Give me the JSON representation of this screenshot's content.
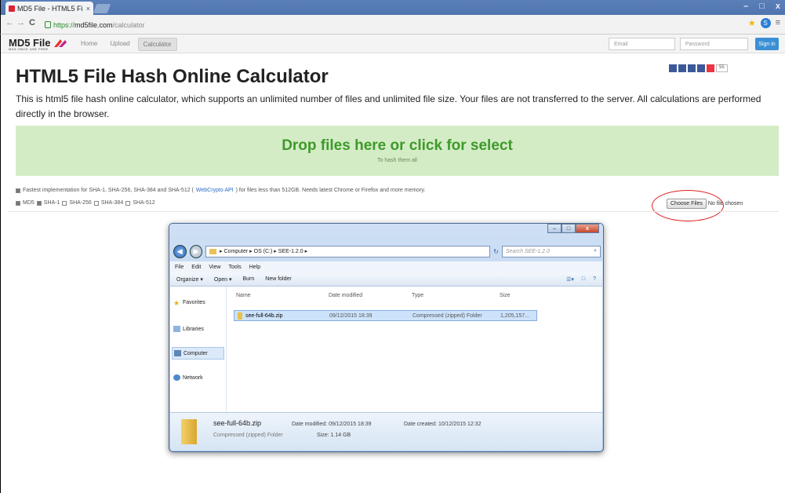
{
  "browser": {
    "tab_title": "MD5 File - HTML5 Fi",
    "tab_close": "×",
    "url_https": "https://",
    "url_host": "md5file.com",
    "url_path": "/calculator",
    "window_controls": [
      "–",
      "□",
      "x"
    ]
  },
  "site": {
    "logo": "MD5 File",
    "logo_sub": "MD5 ONCE USE FREE",
    "nav": [
      "Home",
      "Upload",
      "Calculator"
    ],
    "active_nav": "Calculator",
    "email_placeholder": "Email",
    "password_placeholder": "Password",
    "signin": "Sign in",
    "share_count": "55"
  },
  "main": {
    "title": "HTML5 File Hash Online Calculator",
    "description": "This is html5 file hash online calculator, which supports an unlimited number of files and unlimited file size. Your files are not transferred to the server. All calculations are performed directly in the browser.",
    "drop_title": "Drop files here or click for select",
    "drop_sub": "To hash them all",
    "option_pre": "Fastest implementation for SHA-1, SHA-256, SHA-384 and SHA-512 (",
    "option_link": "WebCrypto API",
    "option_post": ") for files less than 512GB. Needs latest Chrome or Firefox and more memory.",
    "algos": [
      {
        "label": "MD5",
        "checked": true
      },
      {
        "label": "SHA-1",
        "checked": true
      },
      {
        "label": "SHA-256",
        "checked": false
      },
      {
        "label": "SHA-384",
        "checked": false
      },
      {
        "label": "SHA-512",
        "checked": false
      }
    ],
    "choose_files": "Choose Files",
    "no_file": "No file chosen"
  },
  "explorer": {
    "path": "▸ Computer ▸ OS (C:) ▸ SEE-1.2.0 ▸",
    "search_placeholder": "Search SEE-1.2.0",
    "menu": [
      "File",
      "Edit",
      "View",
      "Tools",
      "Help"
    ],
    "commands": [
      "Organize ▾",
      "Open ▾",
      "Burn",
      "New folder"
    ],
    "nav": [
      "Favorites",
      "Libraries",
      "Computer",
      "Network"
    ],
    "columns": [
      "Name",
      "Date modified",
      "Type",
      "Size"
    ],
    "file": {
      "name": "see-full-64b.zip",
      "date": "09/12/2015 18:39",
      "type": "Compressed (zipped) Folder",
      "size": "1,205,157..."
    },
    "detail": {
      "name": "see-full-64b.zip",
      "type": "Compressed (zipped) Folder",
      "modified": "Date modified: 09/12/2015 18:39",
      "size": "Size: 1.14 GB",
      "created": "Date created: 10/12/2015 12:32"
    }
  }
}
